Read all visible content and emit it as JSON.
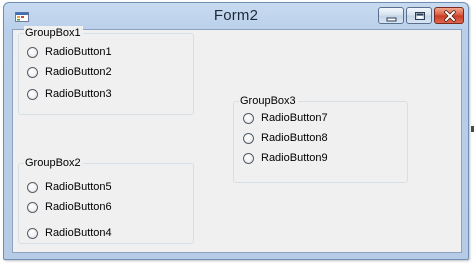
{
  "window": {
    "title": "Form2",
    "icon": "windows-form-icon",
    "controls": [
      "minimize-icon",
      "maximize-icon",
      "close-icon"
    ]
  },
  "groups": [
    {
      "label": "GroupBox1",
      "radios": [
        "RadioButton1",
        "RadioButton2",
        "RadioButton3"
      ]
    },
    {
      "label": "GroupBox2",
      "radios": [
        "RadioButton5",
        "RadioButton6",
        "RadioButton4"
      ]
    },
    {
      "label": "GroupBox3",
      "radios": [
        "RadioButton7",
        "RadioButton8",
        "RadioButton9"
      ]
    }
  ],
  "colors": {
    "window_frame": "#b9cfe9",
    "client_background": "#f0f0f0",
    "close_button": "#c73a22"
  }
}
